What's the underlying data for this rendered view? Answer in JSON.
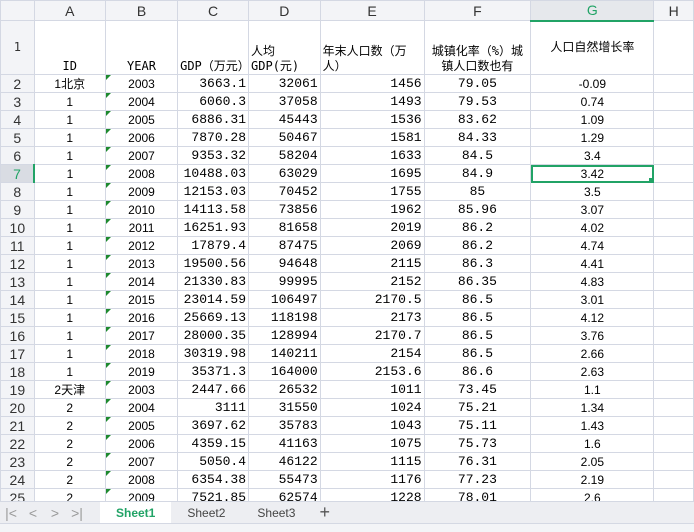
{
  "columns": [
    "A",
    "B",
    "C",
    "D",
    "E",
    "F",
    "G",
    "H"
  ],
  "selected_column": "G",
  "selected_row": 7,
  "headers": {
    "A": "ID",
    "B": "YEAR",
    "C": "GDP（万元）",
    "D": "人均GDP(元)",
    "E": "年末人口数（万人）",
    "F": "城镇化率（%）城镇人口数也有",
    "G": "人口自然增长率"
  },
  "rows": [
    [
      "1北京",
      "2003",
      "3663.1",
      "32061",
      "1456",
      "79.05",
      "-0.09"
    ],
    [
      "1",
      "2004",
      "6060.3",
      "37058",
      "1493",
      "79.53",
      "0.74"
    ],
    [
      "1",
      "2005",
      "6886.31",
      "45443",
      "1536",
      "83.62",
      "1.09"
    ],
    [
      "1",
      "2006",
      "7870.28",
      "50467",
      "1581",
      "84.33",
      "1.29"
    ],
    [
      "1",
      "2007",
      "9353.32",
      "58204",
      "1633",
      "84.5",
      "3.4"
    ],
    [
      "1",
      "2008",
      "10488.03",
      "63029",
      "1695",
      "84.9",
      "3.42"
    ],
    [
      "1",
      "2009",
      "12153.03",
      "70452",
      "1755",
      "85",
      "3.5"
    ],
    [
      "1",
      "2010",
      "14113.58",
      "73856",
      "1962",
      "85.96",
      "3.07"
    ],
    [
      "1",
      "2011",
      "16251.93",
      "81658",
      "2019",
      "86.2",
      "4.02"
    ],
    [
      "1",
      "2012",
      "17879.4",
      "87475",
      "2069",
      "86.2",
      "4.74"
    ],
    [
      "1",
      "2013",
      "19500.56",
      "94648",
      "2115",
      "86.3",
      "4.41"
    ],
    [
      "1",
      "2014",
      "21330.83",
      "99995",
      "2152",
      "86.35",
      "4.83"
    ],
    [
      "1",
      "2015",
      "23014.59",
      "106497",
      "2170.5",
      "86.5",
      "3.01"
    ],
    [
      "1",
      "2016",
      "25669.13",
      "118198",
      "2173",
      "86.5",
      "4.12"
    ],
    [
      "1",
      "2017",
      "28000.35",
      "128994",
      "2170.7",
      "86.5",
      "3.76"
    ],
    [
      "1",
      "2018",
      "30319.98",
      "140211",
      "2154",
      "86.5",
      "2.66"
    ],
    [
      "1",
      "2019",
      "35371.3",
      "164000",
      "2153.6",
      "86.6",
      "2.63"
    ],
    [
      "2天津",
      "2003",
      "2447.66",
      "26532",
      "1011",
      "73.45",
      "1.1"
    ],
    [
      "2",
      "2004",
      "3111",
      "31550",
      "1024",
      "75.21",
      "1.34"
    ],
    [
      "2",
      "2005",
      "3697.62",
      "35783",
      "1043",
      "75.11",
      "1.43"
    ],
    [
      "2",
      "2006",
      "4359.15",
      "41163",
      "1075",
      "75.73",
      "1.6"
    ],
    [
      "2",
      "2007",
      "5050.4",
      "46122",
      "1115",
      "76.31",
      "2.05"
    ],
    [
      "2",
      "2008",
      "6354.38",
      "55473",
      "1176",
      "77.23",
      "2.19"
    ],
    [
      "2",
      "2009",
      "7521.85",
      "62574",
      "1228",
      "78.01",
      "2.6"
    ]
  ],
  "sheets": [
    "Sheet1",
    "Sheet2",
    "Sheet3"
  ],
  "active_sheet": "Sheet1",
  "accent": "#21a366"
}
